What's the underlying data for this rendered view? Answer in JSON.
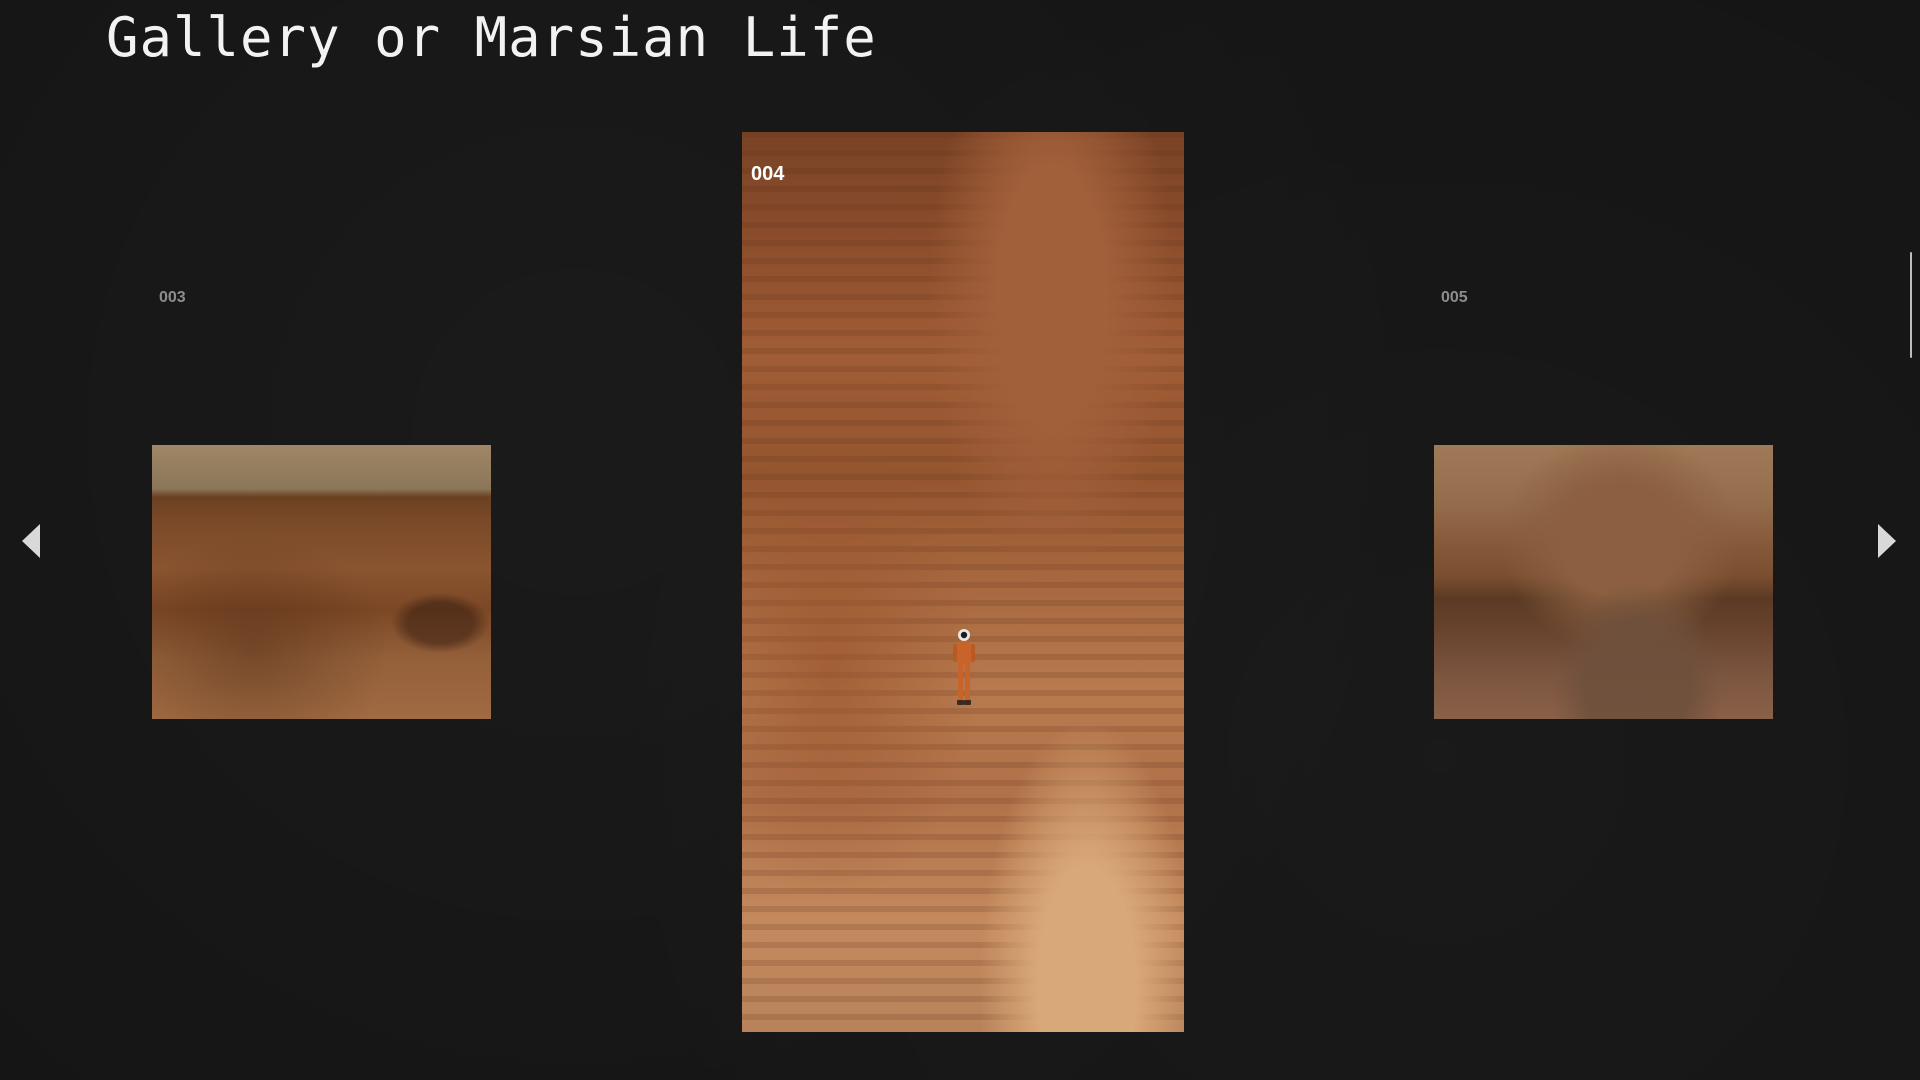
{
  "header": {
    "title": "Gallery or Marsian Life"
  },
  "gallery": {
    "slides": [
      {
        "number": "003",
        "icon": "mars-plain-photo",
        "state": "inactive"
      },
      {
        "number": "004",
        "icon": "astronaut-canyon-photo",
        "state": "active"
      },
      {
        "number": "005",
        "icon": "mars-hills-photo",
        "state": "inactive"
      }
    ],
    "controls": {
      "prev_icon": "triangle-left-icon",
      "next_icon": "triangle-right-icon"
    }
  },
  "colors": {
    "background": "#151515",
    "title": "#f2f2f2",
    "active_number": "#ffffff",
    "inactive_number": "#8d8d8d",
    "arrow": "#d9d9d9"
  }
}
